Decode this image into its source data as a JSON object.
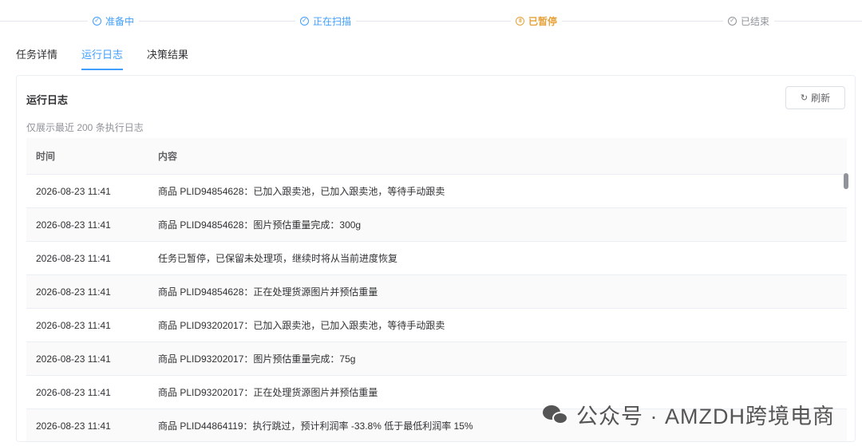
{
  "steps": [
    {
      "label": "准备中",
      "status": "done",
      "icon": "check-circle-icon"
    },
    {
      "label": "正在扫描",
      "status": "done",
      "icon": "check-circle-icon"
    },
    {
      "label": "已暂停",
      "status": "paused",
      "icon": "pause-circle-icon"
    },
    {
      "label": "已结束",
      "status": "wait",
      "icon": "check-circle-icon"
    }
  ],
  "tabs": [
    {
      "label": "任务详情",
      "active": false
    },
    {
      "label": "运行日志",
      "active": true
    },
    {
      "label": "决策结果",
      "active": false
    }
  ],
  "log_panel": {
    "title": "运行日志",
    "refresh_label": "刷新",
    "note": "仅展示最近 200 条执行日志",
    "columns": {
      "time": "时间",
      "content": "内容"
    },
    "rows": [
      {
        "time": "2026-08-23 11:41",
        "content": "商品 PLID94854628：已加入跟卖池，已加入跟卖池，等待手动跟卖"
      },
      {
        "time": "2026-08-23 11:41",
        "content": "商品 PLID94854628：图片预估重量完成：300g"
      },
      {
        "time": "2026-08-23 11:41",
        "content": "任务已暂停，已保留未处理项，继续时将从当前进度恢复"
      },
      {
        "time": "2026-08-23 11:41",
        "content": "商品 PLID94854628：正在处理货源图片并预估重量"
      },
      {
        "time": "2026-08-23 11:41",
        "content": "商品 PLID93202017：已加入跟卖池，已加入跟卖池，等待手动跟卖"
      },
      {
        "time": "2026-08-23 11:41",
        "content": "商品 PLID93202017：图片预估重量完成：75g"
      },
      {
        "time": "2026-08-23 11:41",
        "content": "商品 PLID93202017：正在处理货源图片并预估重量"
      },
      {
        "time": "2026-08-23 11:41",
        "content": "商品 PLID44864119：执行跳过，预计利润率 -33.8% 低于最低利润率 15%"
      }
    ]
  },
  "watermark": "公众号 · AMZDH跨境电商",
  "colors": {
    "accent": "#409eff",
    "paused": "#e6a23c",
    "muted": "#909399"
  }
}
